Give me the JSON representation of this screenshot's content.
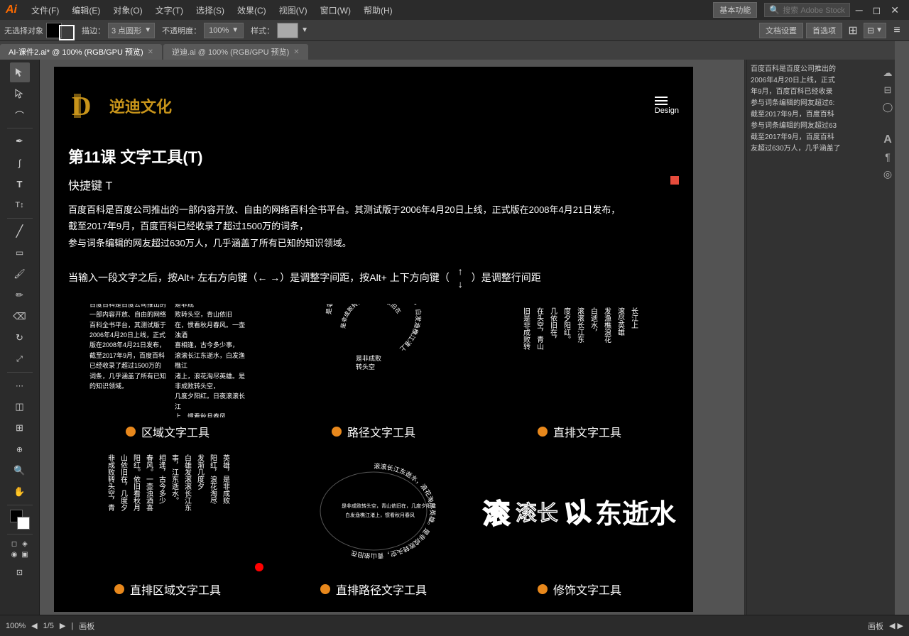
{
  "app": {
    "logo": "Ai",
    "title": "Adobe Illustrator"
  },
  "menubar": {
    "items": [
      "文件(F)",
      "编辑(E)",
      "对象(O)",
      "文字(T)",
      "选择(S)",
      "效果(C)",
      "视图(V)",
      "窗口(W)",
      "帮助(H)"
    ]
  },
  "toolbar": {
    "no_selection": "无选择对象",
    "fill_label": "",
    "stroke_label": "",
    "brush_label": "描边：",
    "point_shape": "3 点圆形",
    "opacity_label": "不透明度：",
    "opacity_value": "100%",
    "style_label": "样式：",
    "doc_settings": "文档设置",
    "preferences": "首选项",
    "search_stock": "搜索 Adobe Stock",
    "basic_func": "基本功能"
  },
  "tabs": [
    {
      "label": "AI-课件2.ai* @ 100% (RGB/GPU 预览)",
      "active": true
    },
    {
      "label": "逆迪.ai @ 100% (RGB/GPU 预览)",
      "active": false
    }
  ],
  "artboard": {
    "header": {
      "logo_symbol": "D",
      "logo_text": "逆迪文化",
      "menu_label": "Design"
    },
    "lesson_title": "第11课   文字工具(T)",
    "shortcut": "快捷键 T",
    "description": "百度百科是百度公司推出的一部内容开放、自由的网络百科全书平台。其测试版于2006年4月20日上线，正式版在2008年4月21日发布，\n截至2017年9月，百度百科已经收录了超过1500万的词条，\n参与词条编辑的网友超过630万人，几乎涵盖了所有已知的知识领域。",
    "instruction": "当输入一段文字之后，按Alt+ 左右方向键（← →）是调整字间距，按Alt+ 上下方向键（  ）是调整行间距",
    "demos": [
      {
        "id": "area-text",
        "label": "区域文字工具",
        "text_content": "百度百科是百度公司推出的一部内容开放、自由的网络百科全书平台，其测试版于2006年4月20日上线，正式版在2008年4月21日发布，截至2017年9月，百度百科已经收录了超过1500万的词条，几乎涵盖了所有已知的知识领域。"
      },
      {
        "id": "path-text",
        "label": "路径文字工具",
        "text_content": "是非成败转头空，青山依旧在，几度夕阳红。白发渔樵江渚上，惯看秋月春风。一壶浊酒喜相逢。古今多少事，都付笑谈中。"
      },
      {
        "id": "vertical-text",
        "label": "直排文字工具",
        "text_content": "滚滚长江东逝水，浪花淘尽英雄。是非成败转头空，青山依旧在，几度夕阳红。白发渔樵江渚上，惯看秋月春风。"
      }
    ],
    "bottom_demos": [
      {
        "id": "vertical-area",
        "label": "直排区域文字工具"
      },
      {
        "id": "vertical-path",
        "label": "直排路径文字工具"
      },
      {
        "id": "decoration-text",
        "label": "修饰文字工具"
      }
    ]
  },
  "properties_panel": {
    "content": "百度百科是百度公司推出的\n2006年4月20日上线，正式\n年9月，百度百科已经收录\n参与词条编辑的网友超过6:\n截至2017年9月，百度百科\n参与词条编辑的网友超过63\n截至2017年9月，百度百科\n友超过630万人，几乎涵盖了"
  },
  "status_bar": {
    "zoom": "100%",
    "page_info": "1/5",
    "artboard_name": "画板"
  }
}
